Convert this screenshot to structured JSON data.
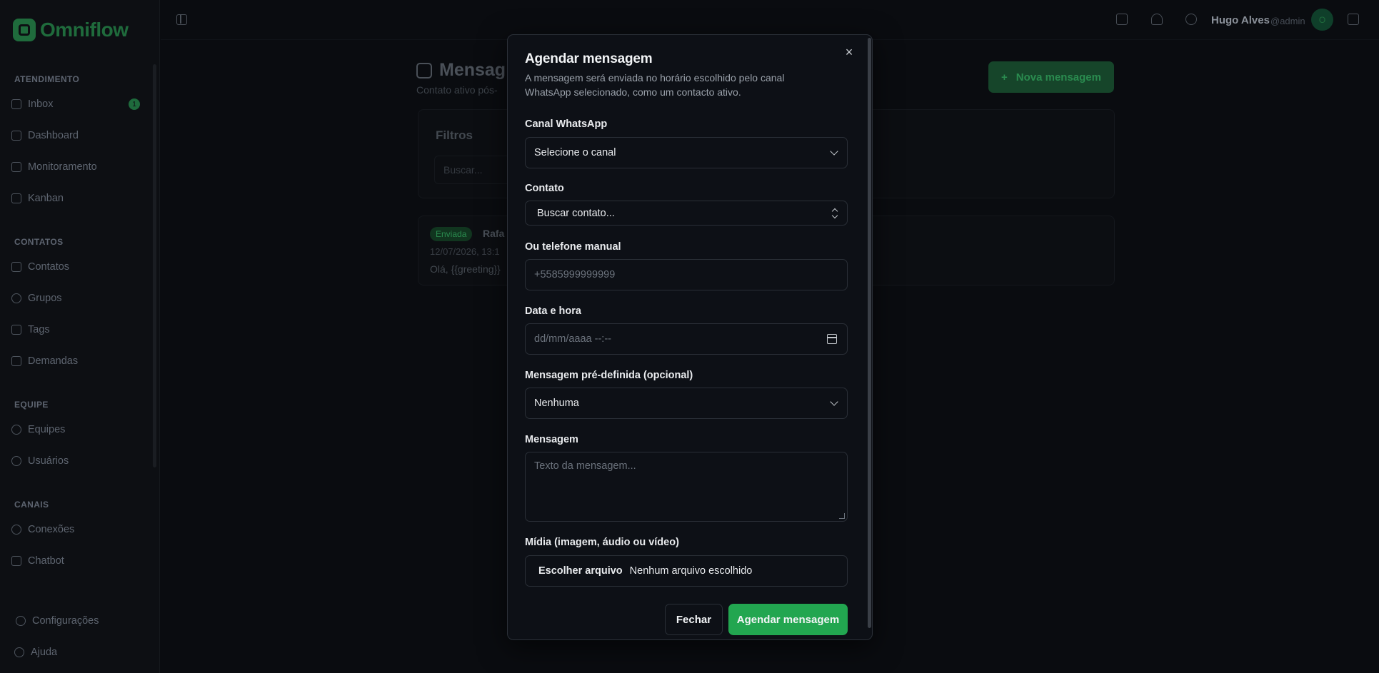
{
  "app": {
    "name": "Omniflow"
  },
  "sidebar": {
    "sections": [
      {
        "title": "ATENDIMENTO",
        "items": [
          {
            "label": "Inbox",
            "badge": "1",
            "icon": "inbox-icon"
          },
          {
            "label": "Dashboard",
            "icon": "dashboard-icon"
          },
          {
            "label": "Monitoramento",
            "icon": "monitor-icon"
          },
          {
            "label": "Kanban",
            "icon": "kanban-icon"
          }
        ]
      },
      {
        "title": "CONTATOS",
        "items": [
          {
            "label": "Contatos",
            "icon": "contacts-icon"
          },
          {
            "label": "Grupos",
            "icon": "groups-icon"
          },
          {
            "label": "Tags",
            "icon": "tag-icon"
          },
          {
            "label": "Demandas",
            "icon": "demands-icon"
          }
        ]
      },
      {
        "title": "EQUIPE",
        "items": [
          {
            "label": "Equipes",
            "icon": "teams-icon"
          },
          {
            "label": "Usuários",
            "icon": "users-icon"
          }
        ]
      },
      {
        "title": "CANAIS",
        "items": [
          {
            "label": "Conexões",
            "icon": "plug-icon"
          },
          {
            "label": "Chatbot",
            "icon": "chatbot-icon"
          }
        ]
      }
    ],
    "footer": [
      {
        "label": "Configurações",
        "icon": "gear-icon"
      },
      {
        "label": "Ajuda",
        "icon": "help-icon"
      }
    ]
  },
  "topbar": {
    "user_name": "Hugo Alves",
    "user_role": "@admin",
    "avatar_initial": "O"
  },
  "page": {
    "title": "Mensag",
    "subtitle": "Contato ativo pós-",
    "new_button": "Nova mensagem",
    "filters_title": "Filtros",
    "search_placeholder": "Buscar...",
    "message": {
      "status": "Enviada",
      "name": "Rafa",
      "date": "12/07/2026, 13:1",
      "text": "Olá, {{greeting}}"
    }
  },
  "modal": {
    "title": "Agendar mensagem",
    "description": "A mensagem será enviada no horário escolhido pelo canal WhatsApp selecionado, como um contacto ativo.",
    "close_symbol": "×",
    "fields": {
      "channel_label": "Canal WhatsApp",
      "channel_value": "Selecione o canal",
      "contact_label": "Contato",
      "contact_value": "Buscar contato...",
      "phone_label": "Ou telefone manual",
      "phone_placeholder": "+5585999999999",
      "datetime_label": "Data e hora",
      "datetime_placeholder": "dd/mm/aaaa --:--",
      "template_label": "Mensagem pré-definida (opcional)",
      "template_value": "Nenhuma",
      "message_label": "Mensagem",
      "message_placeholder": "Texto da mensagem...",
      "media_label": "Mídia (imagem, áudio ou vídeo)",
      "media_button": "Escolher arquivo",
      "media_status": "Nenhum arquivo escolhido"
    },
    "buttons": {
      "cancel": "Fechar",
      "submit": "Agendar mensagem"
    }
  },
  "colors": {
    "primary": "#22a650",
    "background": "#0a0c10",
    "modal": "#0d1016"
  }
}
